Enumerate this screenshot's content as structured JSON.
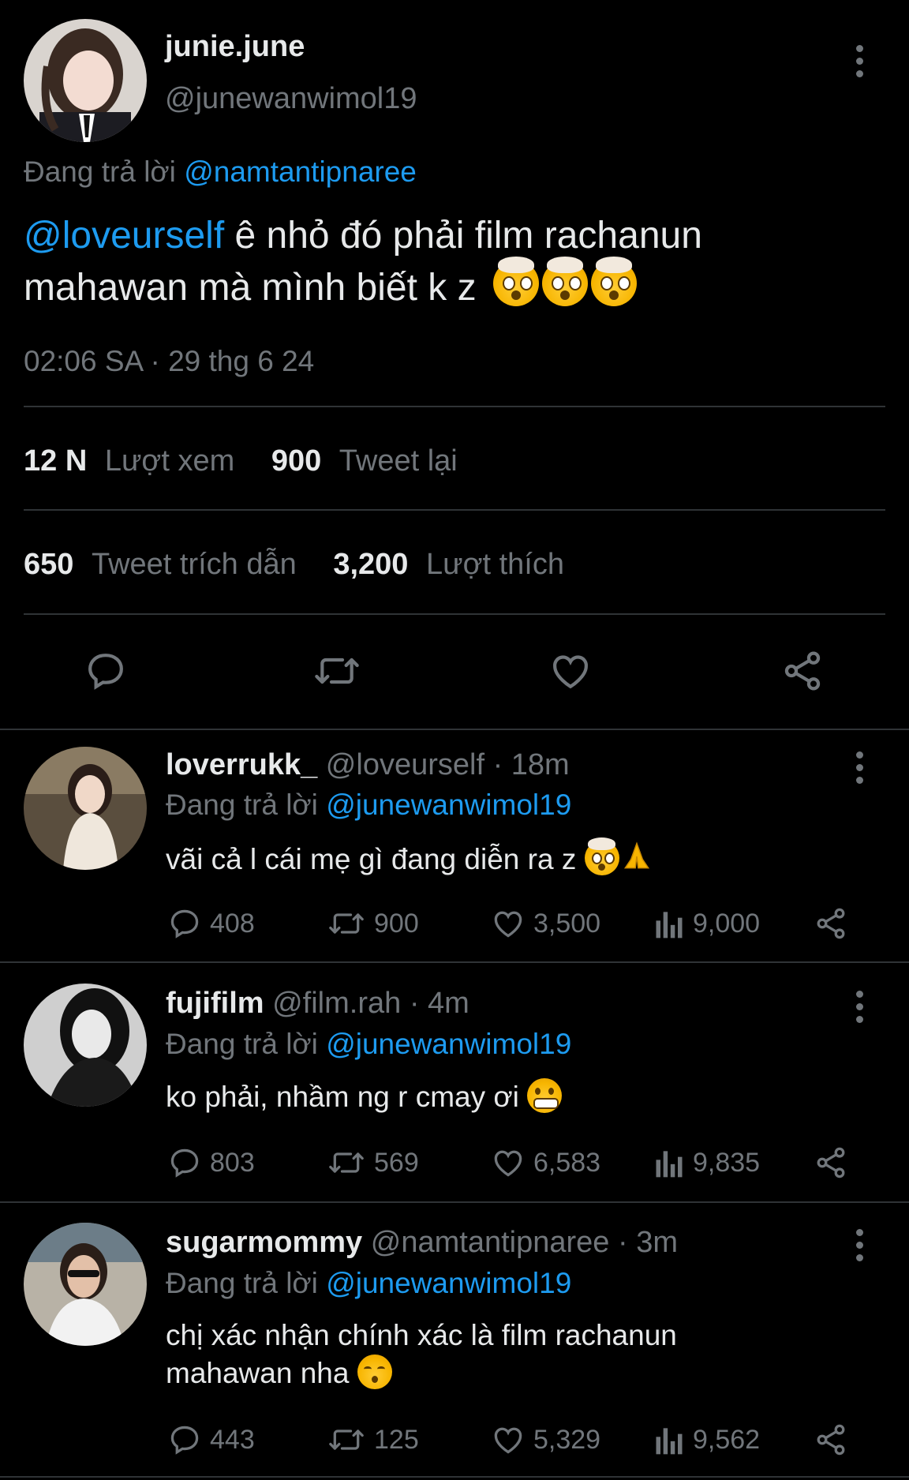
{
  "main_tweet": {
    "display_name": "junie.june",
    "handle": "@junewanwimol19",
    "replying_label": "Đang trả lời",
    "replying_to": "@namtantipnaree",
    "mention": "@loveurself",
    "text_line1": " ê nhỏ đó phải film rachanun",
    "text_line2": "mahawan mà mình biết k z",
    "timestamp": "02:06 SA · 29 thg 6 24",
    "views_num": "12 N",
    "views_label": "Lượt xem",
    "retweets_num": "900",
    "retweets_label": "Tweet lại",
    "quotes_num": "650",
    "quotes_label": "Tweet trích dẫn",
    "likes_num": "3,200",
    "likes_label": "Lượt thích"
  },
  "replies": [
    {
      "display_name": "loverrukk_",
      "handle": "@loveurself",
      "time": " · 18m",
      "replying_label": "Đang trả lời",
      "replying_to": "@junewanwimol19",
      "text": "vãi cả l cái mẹ gì đang diễn ra z",
      "replies": "408",
      "retweets": "900",
      "likes": "3,500",
      "views": "9,000"
    },
    {
      "display_name": "fujifilm",
      "handle": "@film.rah",
      "time": " · 4m",
      "replying_label": "Đang trả lời",
      "replying_to": "@junewanwimol19",
      "text": "ko phải, nhầm ng r cmay ơi",
      "replies": "803",
      "retweets": "569",
      "likes": "6,583",
      "views": "9,835"
    },
    {
      "display_name": "sugarmommy",
      "handle": "@namtantipnaree",
      "time": " · 3m",
      "replying_label": "Đang trả lời",
      "replying_to": "@junewanwimol19",
      "text_line1": "chị xác nhận chính xác là film rachanun",
      "text_line2": "mahawan nha",
      "replies": "443",
      "retweets": "125",
      "likes": "5,329",
      "views": "9,562"
    }
  ],
  "colors": {
    "background": "#000000",
    "text": "#e7e9ea",
    "muted": "#71767b",
    "link": "#1d9bf0",
    "divider": "#2f3336"
  },
  "icons": [
    "kebab-menu-icon",
    "reply-icon",
    "retweet-icon",
    "like-icon",
    "share-icon",
    "views-icon"
  ]
}
